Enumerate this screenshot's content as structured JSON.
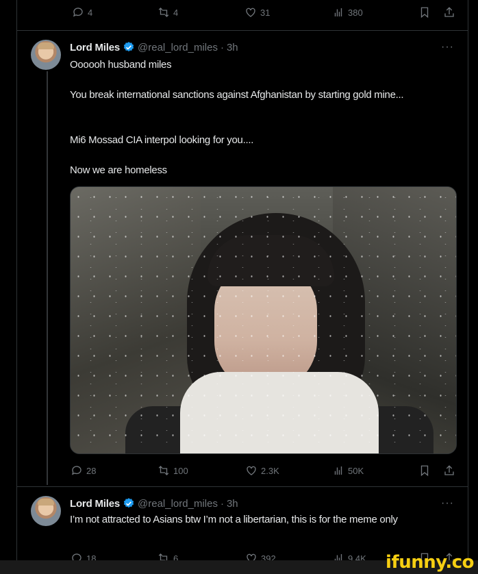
{
  "top_actions": {
    "replies": "4",
    "reposts": "4",
    "likes": "31",
    "views": "380"
  },
  "tweets": [
    {
      "name": "Lord Miles",
      "handle": "@real_lord_miles",
      "time": "3h",
      "more": "···",
      "lines": [
        "Oooooh husband miles",
        "You break international sanctions against Afghanistan by starting gold mine...",
        "Mi6 Mossad CIA interpol looking for you....",
        "Now we are homeless"
      ],
      "actions": {
        "replies": "28",
        "reposts": "100",
        "likes": "2.3K",
        "views": "50K"
      }
    },
    {
      "name": "Lord Miles",
      "handle": "@real_lord_miles",
      "time": "3h",
      "more": "···",
      "lines": [
        "I’m not attracted to Asians btw I’m not a libertarian, this is for the meme only"
      ],
      "actions": {
        "replies": "18",
        "reposts": "6",
        "likes": "392",
        "views": "9.4K"
      }
    }
  ],
  "watermark": "ifunny.co",
  "colors": {
    "background": "#000000",
    "text": "#e7e9ea",
    "muted": "#71767b",
    "verified": "#1d9bf0",
    "watermark": "#f7cf12"
  }
}
